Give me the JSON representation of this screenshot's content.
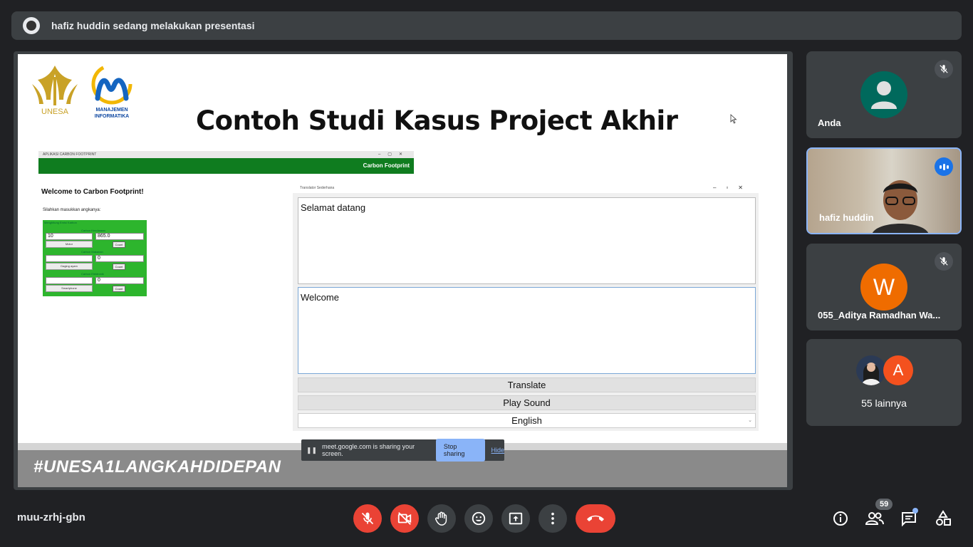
{
  "presenter_banner": {
    "text": "hafiz huddin sedang melakukan presentasi"
  },
  "slide": {
    "logo1_text": "UNESA",
    "logo2_text_line1": "MANAJEMEN",
    "logo2_text_line2": "INFORMATIKA",
    "title": "Contoh Studi Kasus Project Akhir",
    "footer_tag": "#UNESA1LANGKAHDIDEPAN"
  },
  "carbon_app": {
    "window_title": "APLIKASI CARBON FOOTPRINT",
    "header": "Carbon Footprint",
    "welcome": "Welcome to Carbon Footprint!",
    "prompt": "Silahkan masukkan angkanya:",
    "panel_title": "Menghitung Emisi Karbon",
    "kendaraan_label": "Carbon Kendaraan",
    "kendaraan_input": "10",
    "kendaraan_result": "865.0",
    "kendaraan_option": "Motor",
    "makanan_label": "Carbon Makanan",
    "makanan_result": "0",
    "makanan_option": "Daging ayam",
    "elektronik_label": "Carbon Elektronik",
    "elektronik_result": "0",
    "elektronik_option": "Smartphone",
    "count_label": "Count"
  },
  "translator": {
    "window_title": "Translator Sederhana",
    "input_text": "Selamat datang",
    "output_text": "Welcome",
    "translate_button": "Translate",
    "play_button": "Play Sound",
    "language_selected": "English"
  },
  "share_bar": {
    "message": "meet.google.com is sharing your screen.",
    "stop_label": "Stop sharing",
    "hide_label": "Hide"
  },
  "participants": [
    {
      "name": "Anda"
    },
    {
      "name": "hafiz huddin"
    },
    {
      "name": "055_Aditya Ramadhan Wa...",
      "initial": "W"
    },
    {
      "name": "55 lainnya",
      "initial": "A"
    }
  ],
  "meeting": {
    "code": "muu-zrhj-gbn",
    "participant_count": "59"
  },
  "colors": {
    "end_call": "#ea4335",
    "accent": "#8ab4f8",
    "avatar_teal": "#00695c",
    "avatar_orange": "#ef6c00",
    "avatar_red_orange": "#f4511e"
  }
}
